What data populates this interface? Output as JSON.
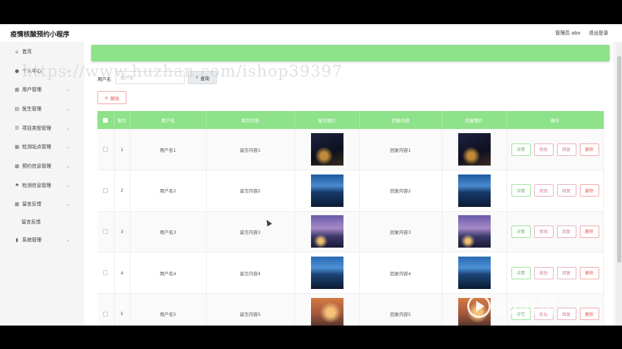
{
  "app": {
    "title": "疫情核酸预约小程序",
    "user_label": "管理员 abo",
    "logout_label": "退出登录"
  },
  "watermark": "https://www.huzhan.com/ishop39397",
  "sidebar": {
    "items": [
      {
        "label": "首页",
        "icon": "home-icon",
        "has_chevron": false
      },
      {
        "label": "个人中心",
        "icon": "user-icon",
        "has_chevron": true
      },
      {
        "label": "用户管理",
        "icon": "grid-icon",
        "has_chevron": true
      },
      {
        "label": "医生管理",
        "icon": "hospital-icon",
        "has_chevron": true
      },
      {
        "label": "项目类型管理",
        "icon": "list-icon",
        "has_chevron": true
      },
      {
        "label": "检测站点管理",
        "icon": "grid-icon",
        "has_chevron": true
      },
      {
        "label": "预约信息管理",
        "icon": "grid-icon",
        "has_chevron": true
      },
      {
        "label": "检测信息管理",
        "icon": "flag-icon",
        "has_chevron": true
      },
      {
        "label": "留言反馈",
        "icon": "grid-icon",
        "has_chevron": true
      }
    ],
    "sub_item": "留言反馈",
    "last_item": {
      "label": "系统管理",
      "icon": "chart-icon",
      "has_chevron": true
    }
  },
  "search": {
    "label": "用户名",
    "placeholder": "用户名",
    "button_label": "查询"
  },
  "delete_label": "删除",
  "table": {
    "headers": [
      "索引",
      "用户名",
      "留言内容",
      "留言图片",
      "回复内容",
      "回复图片",
      "操作"
    ],
    "actions": [
      "详情",
      "修改",
      "回复",
      "删除"
    ],
    "rows": [
      {
        "index": "1",
        "username": "用户名1",
        "message": "留言内容1",
        "reply": "回复内容1",
        "img": "img-1"
      },
      {
        "index": "2",
        "username": "用户名2",
        "message": "留言内容2",
        "reply": "回复内容2",
        "img": "img-2"
      },
      {
        "index": "3",
        "username": "用户名3",
        "message": "留言内容3",
        "reply": "回复内容3",
        "img": "img-3"
      },
      {
        "index": "4",
        "username": "用户名4",
        "message": "留言内容4",
        "reply": "回复内容4",
        "img": "img-4"
      },
      {
        "index": "5",
        "username": "用户名5",
        "message": "留言内容5",
        "reply": "回复内容5",
        "img": "img-5"
      }
    ]
  },
  "overlay_logo": "ev剪辑",
  "colors": {
    "accent": "#8ee28a",
    "danger": "#e06060",
    "edit": "#d07aa0"
  }
}
